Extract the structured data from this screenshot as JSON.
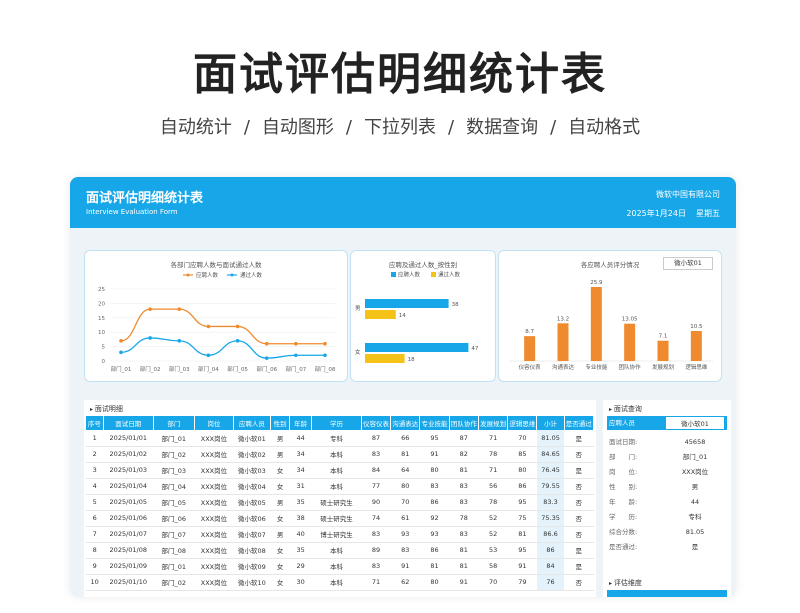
{
  "hero": {
    "title": "面试评估明细统计表",
    "features": [
      "自动统计",
      "/",
      "自动图形",
      "/",
      "下拉列表",
      "/",
      "数据查询",
      "/",
      "自动格式"
    ]
  },
  "header": {
    "title": "面试评估明细统计表",
    "subtitle": "Interview Evaluation Form",
    "company": "微软中国有限公司",
    "date": "2025年1月24日",
    "weekday": "星期五"
  },
  "colors": {
    "accent": "#17a7e8",
    "orange": "#f08a2e",
    "yellow": "#f5c317",
    "blue": "#17a7e8"
  },
  "chart_data": [
    {
      "type": "line",
      "title": "各部门应聘人数与面试通过人数",
      "categories": [
        "部门_01",
        "部门_02",
        "部门_03",
        "部门_04",
        "部门_05",
        "部门_06",
        "部门_07",
        "部门_08"
      ],
      "series": [
        {
          "name": "应聘人数",
          "values": [
            7,
            18,
            18,
            12,
            12,
            6,
            6,
            6
          ]
        },
        {
          "name": "通过人数",
          "values": [
            3,
            8,
            7,
            2,
            7,
            1,
            2,
            2
          ]
        }
      ],
      "ylim": [
        0,
        25
      ],
      "yticks": [
        0,
        5,
        10,
        15,
        20,
        25
      ],
      "legend": "top"
    },
    {
      "type": "bar",
      "orientation": "horizontal",
      "title": "应聘及通过人数_按性别",
      "categories": [
        "男",
        "女"
      ],
      "series": [
        {
          "name": "应聘人数",
          "values": [
            38,
            47
          ]
        },
        {
          "name": "通过人数",
          "values": [
            14,
            18
          ]
        }
      ],
      "legend": "top"
    },
    {
      "type": "bar",
      "title": "各应聘人员评分情况",
      "categories": [
        "仪容仪表",
        "沟通表达",
        "专业技能",
        "团队协作",
        "发展规划",
        "逻辑思维"
      ],
      "values": [
        8.7,
        13.2,
        25.9,
        13.05,
        7.1,
        10.5
      ],
      "ylim": [
        0,
        28
      ]
    }
  ],
  "score_chart_dropdown": "微小软01",
  "table": {
    "section": "面试明细",
    "columns": [
      "序号",
      "面试日期",
      "部门",
      "岗位",
      "应聘人员",
      "性别",
      "年龄",
      "学历",
      "仪容仪表",
      "沟通表达",
      "专业技能",
      "团队协作",
      "发展规划",
      "逻辑思维",
      "小计",
      "是否通过"
    ],
    "rows": [
      [
        "1",
        "2025/01/01",
        "部门_01",
        "XXX岗位",
        "微小软01",
        "男",
        "44",
        "专科",
        "87",
        "66",
        "95",
        "87",
        "71",
        "70",
        "81.05",
        "是"
      ],
      [
        "2",
        "2025/01/02",
        "部门_02",
        "XXX岗位",
        "微小软02",
        "男",
        "34",
        "本科",
        "83",
        "81",
        "91",
        "82",
        "78",
        "85",
        "84.65",
        "否"
      ],
      [
        "3",
        "2025/01/03",
        "部门_03",
        "XXX岗位",
        "微小软03",
        "女",
        "34",
        "本科",
        "84",
        "64",
        "80",
        "81",
        "71",
        "80",
        "76.45",
        "是"
      ],
      [
        "4",
        "2025/01/04",
        "部门_04",
        "XXX岗位",
        "微小软04",
        "女",
        "31",
        "本科",
        "77",
        "80",
        "83",
        "83",
        "56",
        "86",
        "79.55",
        "否"
      ],
      [
        "5",
        "2025/01/05",
        "部门_05",
        "XXX岗位",
        "微小软05",
        "男",
        "35",
        "硕士研究生",
        "90",
        "70",
        "86",
        "83",
        "78",
        "95",
        "83.3",
        "否"
      ],
      [
        "6",
        "2025/01/06",
        "部门_06",
        "XXX岗位",
        "微小软06",
        "女",
        "38",
        "硕士研究生",
        "74",
        "61",
        "92",
        "78",
        "52",
        "75",
        "75.35",
        "否"
      ],
      [
        "7",
        "2025/01/07",
        "部门_07",
        "XXX岗位",
        "微小软07",
        "男",
        "40",
        "博士研究生",
        "83",
        "93",
        "93",
        "83",
        "52",
        "81",
        "86.6",
        "否"
      ],
      [
        "8",
        "2025/01/08",
        "部门_08",
        "XXX岗位",
        "微小软08",
        "女",
        "35",
        "本科",
        "89",
        "83",
        "86",
        "81",
        "53",
        "95",
        "86",
        "是"
      ],
      [
        "9",
        "2025/01/09",
        "部门_01",
        "XXX岗位",
        "微小软09",
        "女",
        "29",
        "本科",
        "83",
        "91",
        "81",
        "81",
        "58",
        "91",
        "84",
        "是"
      ],
      [
        "10",
        "2025/01/10",
        "部门_02",
        "XXX岗位",
        "微小软10",
        "女",
        "30",
        "本科",
        "71",
        "62",
        "80",
        "91",
        "70",
        "79",
        "76",
        "否"
      ]
    ]
  },
  "query": {
    "section": "面试查询",
    "person_label": "应聘人员",
    "person_value": "微小软01",
    "fields": [
      {
        "k": "面试日期:",
        "v": "45658"
      },
      {
        "k": "部　　门:",
        "v": "部门_01"
      },
      {
        "k": "岗　　位:",
        "v": "XXX岗位"
      },
      {
        "k": "性　　别:",
        "v": "男"
      },
      {
        "k": "年　　龄:",
        "v": "44"
      },
      {
        "k": "学　　历:",
        "v": "专科"
      },
      {
        "k": "综合分数:",
        "v": "81.05"
      },
      {
        "k": "是否通过:",
        "v": "是"
      }
    ],
    "section2": "评估维度"
  }
}
